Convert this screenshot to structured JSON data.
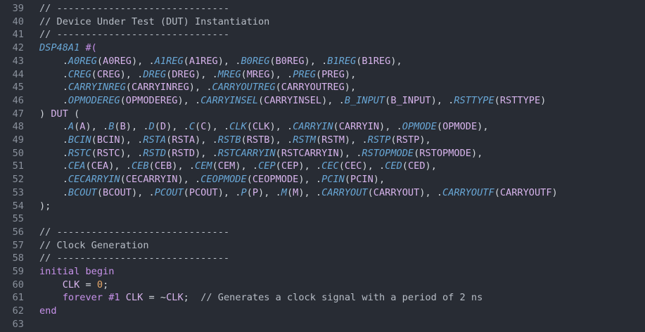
{
  "colors": {
    "background": "#282c34",
    "line_number": "#8a919c",
    "comment": "#b7bdc6",
    "keyword": "#c792ea",
    "module_or_port": "#69a7d6",
    "identifier": "#d7b4ec",
    "number": "#e6a769",
    "punctuation": "#cfd4da"
  },
  "lines": [
    {
      "n": "39",
      "tokens": [
        {
          "t": "// ------------------------------",
          "c": "c"
        }
      ]
    },
    {
      "n": "40",
      "tokens": [
        {
          "t": "// Device Under Test (DUT) Instantiation",
          "c": "c"
        }
      ]
    },
    {
      "n": "41",
      "tokens": [
        {
          "t": "// ------------------------------",
          "c": "c"
        }
      ]
    },
    {
      "n": "42",
      "tokens": [
        {
          "t": "DSP48A1",
          "c": "m"
        },
        {
          "t": " #(",
          "c": "k"
        }
      ]
    },
    {
      "n": "43",
      "tokens": [
        {
          "t": "    .",
          "c": "p"
        },
        {
          "t": "A0REG",
          "c": "m"
        },
        {
          "t": "(",
          "c": "p"
        },
        {
          "t": "A0REG",
          "c": "i"
        },
        {
          "t": "), .",
          "c": "p"
        },
        {
          "t": "A1REG",
          "c": "m"
        },
        {
          "t": "(",
          "c": "p"
        },
        {
          "t": "A1REG",
          "c": "i"
        },
        {
          "t": "), .",
          "c": "p"
        },
        {
          "t": "B0REG",
          "c": "m"
        },
        {
          "t": "(",
          "c": "p"
        },
        {
          "t": "B0REG",
          "c": "i"
        },
        {
          "t": "), .",
          "c": "p"
        },
        {
          "t": "B1REG",
          "c": "m"
        },
        {
          "t": "(",
          "c": "p"
        },
        {
          "t": "B1REG",
          "c": "i"
        },
        {
          "t": "),",
          "c": "p"
        }
      ]
    },
    {
      "n": "44",
      "tokens": [
        {
          "t": "    .",
          "c": "p"
        },
        {
          "t": "CREG",
          "c": "m"
        },
        {
          "t": "(",
          "c": "p"
        },
        {
          "t": "CREG",
          "c": "i"
        },
        {
          "t": "), .",
          "c": "p"
        },
        {
          "t": "DREG",
          "c": "m"
        },
        {
          "t": "(",
          "c": "p"
        },
        {
          "t": "DREG",
          "c": "i"
        },
        {
          "t": "), .",
          "c": "p"
        },
        {
          "t": "MREG",
          "c": "m"
        },
        {
          "t": "(",
          "c": "p"
        },
        {
          "t": "MREG",
          "c": "i"
        },
        {
          "t": "), .",
          "c": "p"
        },
        {
          "t": "PREG",
          "c": "m"
        },
        {
          "t": "(",
          "c": "p"
        },
        {
          "t": "PREG",
          "c": "i"
        },
        {
          "t": "),",
          "c": "p"
        }
      ]
    },
    {
      "n": "45",
      "tokens": [
        {
          "t": "    .",
          "c": "p"
        },
        {
          "t": "CARRYINREG",
          "c": "m"
        },
        {
          "t": "(",
          "c": "p"
        },
        {
          "t": "CARRYINREG",
          "c": "i"
        },
        {
          "t": "), .",
          "c": "p"
        },
        {
          "t": "CARRYOUTREG",
          "c": "m"
        },
        {
          "t": "(",
          "c": "p"
        },
        {
          "t": "CARRYOUTREG",
          "c": "i"
        },
        {
          "t": "),",
          "c": "p"
        }
      ]
    },
    {
      "n": "46",
      "tokens": [
        {
          "t": "    .",
          "c": "p"
        },
        {
          "t": "OPMODEREG",
          "c": "m"
        },
        {
          "t": "(",
          "c": "p"
        },
        {
          "t": "OPMODEREG",
          "c": "i"
        },
        {
          "t": "), .",
          "c": "p"
        },
        {
          "t": "CARRYINSEL",
          "c": "m"
        },
        {
          "t": "(",
          "c": "p"
        },
        {
          "t": "CARRYINSEL",
          "c": "i"
        },
        {
          "t": "), .",
          "c": "p"
        },
        {
          "t": "B_INPUT",
          "c": "m"
        },
        {
          "t": "(",
          "c": "p"
        },
        {
          "t": "B_INPUT",
          "c": "i"
        },
        {
          "t": "), .",
          "c": "p"
        },
        {
          "t": "RSTTYPE",
          "c": "m"
        },
        {
          "t": "(",
          "c": "p"
        },
        {
          "t": "RSTTYPE",
          "c": "i"
        },
        {
          "t": ")",
          "c": "p"
        }
      ]
    },
    {
      "n": "47",
      "tokens": [
        {
          "t": ") ",
          "c": "p"
        },
        {
          "t": "DUT",
          "c": "i"
        },
        {
          "t": " (",
          "c": "p"
        }
      ]
    },
    {
      "n": "48",
      "tokens": [
        {
          "t": "    .",
          "c": "p"
        },
        {
          "t": "A",
          "c": "m"
        },
        {
          "t": "(",
          "c": "p"
        },
        {
          "t": "A",
          "c": "i"
        },
        {
          "t": "), .",
          "c": "p"
        },
        {
          "t": "B",
          "c": "m"
        },
        {
          "t": "(",
          "c": "p"
        },
        {
          "t": "B",
          "c": "i"
        },
        {
          "t": "), .",
          "c": "p"
        },
        {
          "t": "D",
          "c": "m"
        },
        {
          "t": "(",
          "c": "p"
        },
        {
          "t": "D",
          "c": "i"
        },
        {
          "t": "), .",
          "c": "p"
        },
        {
          "t": "C",
          "c": "m"
        },
        {
          "t": "(",
          "c": "p"
        },
        {
          "t": "C",
          "c": "i"
        },
        {
          "t": "), .",
          "c": "p"
        },
        {
          "t": "CLK",
          "c": "m"
        },
        {
          "t": "(",
          "c": "p"
        },
        {
          "t": "CLK",
          "c": "i"
        },
        {
          "t": "), .",
          "c": "p"
        },
        {
          "t": "CARRYIN",
          "c": "m"
        },
        {
          "t": "(",
          "c": "p"
        },
        {
          "t": "CARRYIN",
          "c": "i"
        },
        {
          "t": "), .",
          "c": "p"
        },
        {
          "t": "OPMODE",
          "c": "m"
        },
        {
          "t": "(",
          "c": "p"
        },
        {
          "t": "OPMODE",
          "c": "i"
        },
        {
          "t": "),",
          "c": "p"
        }
      ]
    },
    {
      "n": "49",
      "tokens": [
        {
          "t": "    .",
          "c": "p"
        },
        {
          "t": "BCIN",
          "c": "m"
        },
        {
          "t": "(",
          "c": "p"
        },
        {
          "t": "BCIN",
          "c": "i"
        },
        {
          "t": "), .",
          "c": "p"
        },
        {
          "t": "RSTA",
          "c": "m"
        },
        {
          "t": "(",
          "c": "p"
        },
        {
          "t": "RSTA",
          "c": "i"
        },
        {
          "t": "), .",
          "c": "p"
        },
        {
          "t": "RSTB",
          "c": "m"
        },
        {
          "t": "(",
          "c": "p"
        },
        {
          "t": "RSTB",
          "c": "i"
        },
        {
          "t": "), .",
          "c": "p"
        },
        {
          "t": "RSTM",
          "c": "m"
        },
        {
          "t": "(",
          "c": "p"
        },
        {
          "t": "RSTM",
          "c": "i"
        },
        {
          "t": "), .",
          "c": "p"
        },
        {
          "t": "RSTP",
          "c": "m"
        },
        {
          "t": "(",
          "c": "p"
        },
        {
          "t": "RSTP",
          "c": "i"
        },
        {
          "t": "),",
          "c": "p"
        }
      ]
    },
    {
      "n": "50",
      "tokens": [
        {
          "t": "    .",
          "c": "p"
        },
        {
          "t": "RSTC",
          "c": "m"
        },
        {
          "t": "(",
          "c": "p"
        },
        {
          "t": "RSTC",
          "c": "i"
        },
        {
          "t": "), .",
          "c": "p"
        },
        {
          "t": "RSTD",
          "c": "m"
        },
        {
          "t": "(",
          "c": "p"
        },
        {
          "t": "RSTD",
          "c": "i"
        },
        {
          "t": "), .",
          "c": "p"
        },
        {
          "t": "RSTCARRYIN",
          "c": "m"
        },
        {
          "t": "(",
          "c": "p"
        },
        {
          "t": "RSTCARRYIN",
          "c": "i"
        },
        {
          "t": "), .",
          "c": "p"
        },
        {
          "t": "RSTOPMODE",
          "c": "m"
        },
        {
          "t": "(",
          "c": "p"
        },
        {
          "t": "RSTOPMODE",
          "c": "i"
        },
        {
          "t": "),",
          "c": "p"
        }
      ]
    },
    {
      "n": "51",
      "tokens": [
        {
          "t": "    .",
          "c": "p"
        },
        {
          "t": "CEA",
          "c": "m"
        },
        {
          "t": "(",
          "c": "p"
        },
        {
          "t": "CEA",
          "c": "i"
        },
        {
          "t": "), .",
          "c": "p"
        },
        {
          "t": "CEB",
          "c": "m"
        },
        {
          "t": "(",
          "c": "p"
        },
        {
          "t": "CEB",
          "c": "i"
        },
        {
          "t": "), .",
          "c": "p"
        },
        {
          "t": "CEM",
          "c": "m"
        },
        {
          "t": "(",
          "c": "p"
        },
        {
          "t": "CEM",
          "c": "i"
        },
        {
          "t": "), .",
          "c": "p"
        },
        {
          "t": "CEP",
          "c": "m"
        },
        {
          "t": "(",
          "c": "p"
        },
        {
          "t": "CEP",
          "c": "i"
        },
        {
          "t": "), .",
          "c": "p"
        },
        {
          "t": "CEC",
          "c": "m"
        },
        {
          "t": "(",
          "c": "p"
        },
        {
          "t": "CEC",
          "c": "i"
        },
        {
          "t": "), .",
          "c": "p"
        },
        {
          "t": "CED",
          "c": "m"
        },
        {
          "t": "(",
          "c": "p"
        },
        {
          "t": "CED",
          "c": "i"
        },
        {
          "t": "),",
          "c": "p"
        }
      ]
    },
    {
      "n": "52",
      "tokens": [
        {
          "t": "    .",
          "c": "p"
        },
        {
          "t": "CECARRYIN",
          "c": "m"
        },
        {
          "t": "(",
          "c": "p"
        },
        {
          "t": "CECARRYIN",
          "c": "i"
        },
        {
          "t": "), .",
          "c": "p"
        },
        {
          "t": "CEOPMODE",
          "c": "m"
        },
        {
          "t": "(",
          "c": "p"
        },
        {
          "t": "CEOPMODE",
          "c": "i"
        },
        {
          "t": "), .",
          "c": "p"
        },
        {
          "t": "PCIN",
          "c": "m"
        },
        {
          "t": "(",
          "c": "p"
        },
        {
          "t": "PCIN",
          "c": "i"
        },
        {
          "t": "),",
          "c": "p"
        }
      ]
    },
    {
      "n": "53",
      "tokens": [
        {
          "t": "    .",
          "c": "p"
        },
        {
          "t": "BCOUT",
          "c": "m"
        },
        {
          "t": "(",
          "c": "p"
        },
        {
          "t": "BCOUT",
          "c": "i"
        },
        {
          "t": "), .",
          "c": "p"
        },
        {
          "t": "PCOUT",
          "c": "m"
        },
        {
          "t": "(",
          "c": "p"
        },
        {
          "t": "PCOUT",
          "c": "i"
        },
        {
          "t": "), .",
          "c": "p"
        },
        {
          "t": "P",
          "c": "m"
        },
        {
          "t": "(",
          "c": "p"
        },
        {
          "t": "P",
          "c": "i"
        },
        {
          "t": "), .",
          "c": "p"
        },
        {
          "t": "M",
          "c": "m"
        },
        {
          "t": "(",
          "c": "p"
        },
        {
          "t": "M",
          "c": "i"
        },
        {
          "t": "), .",
          "c": "p"
        },
        {
          "t": "CARRYOUT",
          "c": "m"
        },
        {
          "t": "(",
          "c": "p"
        },
        {
          "t": "CARRYOUT",
          "c": "i"
        },
        {
          "t": "), .",
          "c": "p"
        },
        {
          "t": "CARRYOUTF",
          "c": "m"
        },
        {
          "t": "(",
          "c": "p"
        },
        {
          "t": "CARRYOUTF",
          "c": "i"
        },
        {
          "t": ")",
          "c": "p"
        }
      ]
    },
    {
      "n": "54",
      "tokens": [
        {
          "t": ");",
          "c": "p"
        }
      ]
    },
    {
      "n": "55",
      "tokens": []
    },
    {
      "n": "56",
      "tokens": [
        {
          "t": "// ------------------------------",
          "c": "c"
        }
      ]
    },
    {
      "n": "57",
      "tokens": [
        {
          "t": "// Clock Generation",
          "c": "c"
        }
      ]
    },
    {
      "n": "58",
      "tokens": [
        {
          "t": "// ------------------------------",
          "c": "c"
        }
      ]
    },
    {
      "n": "59",
      "tokens": [
        {
          "t": "initial",
          "c": "k"
        },
        {
          "t": " ",
          "c": "p"
        },
        {
          "t": "begin",
          "c": "k"
        }
      ]
    },
    {
      "n": "60",
      "tokens": [
        {
          "t": "    ",
          "c": "p"
        },
        {
          "t": "CLK",
          "c": "i"
        },
        {
          "t": " = ",
          "c": "p"
        },
        {
          "t": "0",
          "c": "n"
        },
        {
          "t": ";",
          "c": "p"
        }
      ]
    },
    {
      "n": "61",
      "tokens": [
        {
          "t": "    ",
          "c": "p"
        },
        {
          "t": "forever",
          "c": "k"
        },
        {
          "t": " ",
          "c": "p"
        },
        {
          "t": "#1",
          "c": "k"
        },
        {
          "t": " ",
          "c": "p"
        },
        {
          "t": "CLK",
          "c": "i"
        },
        {
          "t": " = ~",
          "c": "p"
        },
        {
          "t": "CLK",
          "c": "i"
        },
        {
          "t": ";  ",
          "c": "p"
        },
        {
          "t": "// Generates a clock signal with a period of 2 ns",
          "c": "c"
        }
      ]
    },
    {
      "n": "62",
      "tokens": [
        {
          "t": "end",
          "c": "k"
        }
      ]
    },
    {
      "n": "63",
      "tokens": []
    }
  ]
}
